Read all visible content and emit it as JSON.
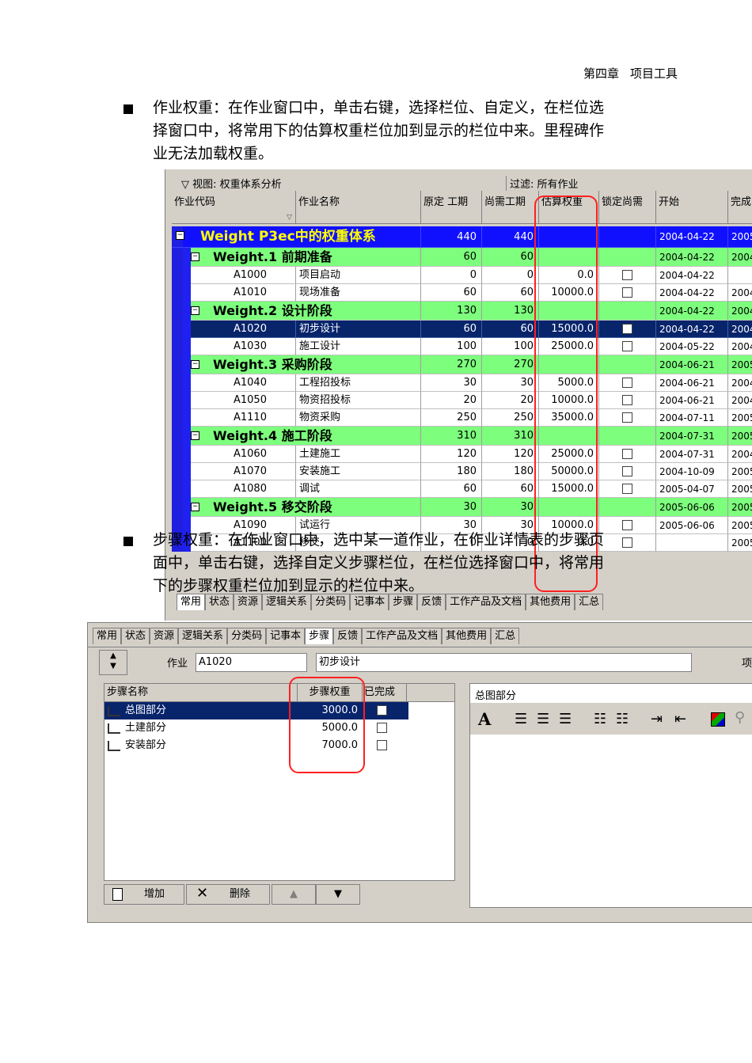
{
  "header": {
    "chapter": "第四章",
    "title": "项目工具"
  },
  "para1": {
    "lines": [
      "作业权重：在作业窗口中，单击右键，选择栏位、自定义，在栏位选",
      "择窗口中，将常用下的估算权重栏位加到显示的栏位中来。里程碑作",
      "业无法加载权重。"
    ]
  },
  "para2": {
    "lines": [
      "步骤权重：在作业窗口中，选中某一道作业，在作业详情表的步骤页",
      "面中，单击右键，选择自定义步骤栏位，在栏位选择窗口中，将常用",
      "下的步骤权重栏位加到显示的栏位中来。"
    ]
  },
  "shot1": {
    "view_label": "视图: 权重体系分析",
    "filter_label": "过滤: 所有作业",
    "columns": [
      "作业代码",
      "作业名称",
      "原定 工期",
      "尚需工期",
      "估算权重",
      "锁定尚需",
      "开始",
      "完成"
    ],
    "rows": [
      {
        "type": "top",
        "code": "",
        "name": "Weight P3ec中的权重体系",
        "orig": "440",
        "rem": "440",
        "weight": "",
        "start": "2004-04-22",
        "finish": "2005-"
      },
      {
        "type": "wbs",
        "code": "",
        "name": "Weight.1 前期准备",
        "orig": "60",
        "rem": "60",
        "weight": "",
        "start": "2004-04-22",
        "finish": "2004-"
      },
      {
        "type": "act",
        "code": "A1000",
        "name": "项目启动",
        "orig": "0",
        "rem": "0",
        "weight": "0.0",
        "start": "2004-04-22",
        "finish": ""
      },
      {
        "type": "act",
        "code": "A1010",
        "name": "现场准备",
        "orig": "60",
        "rem": "60",
        "weight": "10000.0",
        "start": "2004-04-22",
        "finish": "2004-"
      },
      {
        "type": "wbs",
        "code": "",
        "name": "Weight.2 设计阶段",
        "orig": "130",
        "rem": "130",
        "weight": "",
        "start": "2004-04-22",
        "finish": "2004-"
      },
      {
        "type": "sel",
        "code": "A1020",
        "name": "初步设计",
        "orig": "60",
        "rem": "60",
        "weight": "15000.0",
        "start": "2004-04-22",
        "finish": "2004-"
      },
      {
        "type": "act",
        "code": "A1030",
        "name": "施工设计",
        "orig": "100",
        "rem": "100",
        "weight": "25000.0",
        "start": "2004-05-22",
        "finish": "2004-"
      },
      {
        "type": "wbs",
        "code": "",
        "name": "Weight.3 采购阶段",
        "orig": "270",
        "rem": "270",
        "weight": "",
        "start": "2004-06-21",
        "finish": "2005-"
      },
      {
        "type": "act",
        "code": "A1040",
        "name": "工程招投标",
        "orig": "30",
        "rem": "30",
        "weight": "5000.0",
        "start": "2004-06-21",
        "finish": "2004-"
      },
      {
        "type": "act",
        "code": "A1050",
        "name": "物资招投标",
        "orig": "20",
        "rem": "20",
        "weight": "10000.0",
        "start": "2004-06-21",
        "finish": "2004-"
      },
      {
        "type": "act",
        "code": "A1110",
        "name": "物资采购",
        "orig": "250",
        "rem": "250",
        "weight": "35000.0",
        "start": "2004-07-11",
        "finish": "2005-"
      },
      {
        "type": "wbs",
        "code": "",
        "name": "Weight.4 施工阶段",
        "orig": "310",
        "rem": "310",
        "weight": "",
        "start": "2004-07-31",
        "finish": "2005-"
      },
      {
        "type": "act",
        "code": "A1060",
        "name": "土建施工",
        "orig": "120",
        "rem": "120",
        "weight": "25000.0",
        "start": "2004-07-31",
        "finish": "2004-"
      },
      {
        "type": "act",
        "code": "A1070",
        "name": "安装施工",
        "orig": "180",
        "rem": "180",
        "weight": "50000.0",
        "start": "2004-10-09",
        "finish": "2005-"
      },
      {
        "type": "act",
        "code": "A1080",
        "name": "调试",
        "orig": "60",
        "rem": "60",
        "weight": "15000.0",
        "start": "2005-04-07",
        "finish": "2005-"
      },
      {
        "type": "wbs",
        "code": "",
        "name": "Weight.5 移交阶段",
        "orig": "30",
        "rem": "30",
        "weight": "",
        "start": "2005-06-06",
        "finish": "2005-"
      },
      {
        "type": "act",
        "code": "A1090",
        "name": "试运行",
        "orig": "30",
        "rem": "30",
        "weight": "10000.0",
        "start": "2005-06-06",
        "finish": "2005-"
      },
      {
        "type": "act",
        "code": "A1100",
        "name": "移交",
        "orig": "0",
        "rem": "0",
        "weight": "0.0",
        "start": "",
        "finish": "2005-"
      }
    ],
    "tabs": [
      "常用",
      "状态",
      "资源",
      "逻辑关系",
      "分类码",
      "记事本",
      "步骤",
      "反馈",
      "工作产品及文档",
      "其他费用",
      "汇总"
    ]
  },
  "shot2": {
    "tabs": [
      "常用",
      "状态",
      "资源",
      "逻辑关系",
      "分类码",
      "记事本",
      "步骤",
      "反馈",
      "工作产品及文档",
      "其他费用",
      "汇总"
    ],
    "activity_label": "作业",
    "activity_code": "A1020",
    "activity_name": "初步设计",
    "right_cut_label": "项",
    "step_columns": [
      "步骤名称",
      "步骤权重",
      "已完成"
    ],
    "steps": [
      {
        "name": "总图部分",
        "weight": "3000.0"
      },
      {
        "name": "土建部分",
        "weight": "5000.0"
      },
      {
        "name": "安装部分",
        "weight": "7000.0"
      }
    ],
    "detail_title": "总图部分",
    "buttons": {
      "add": "增加",
      "delete": "删除"
    },
    "font_glyph": "A"
  }
}
